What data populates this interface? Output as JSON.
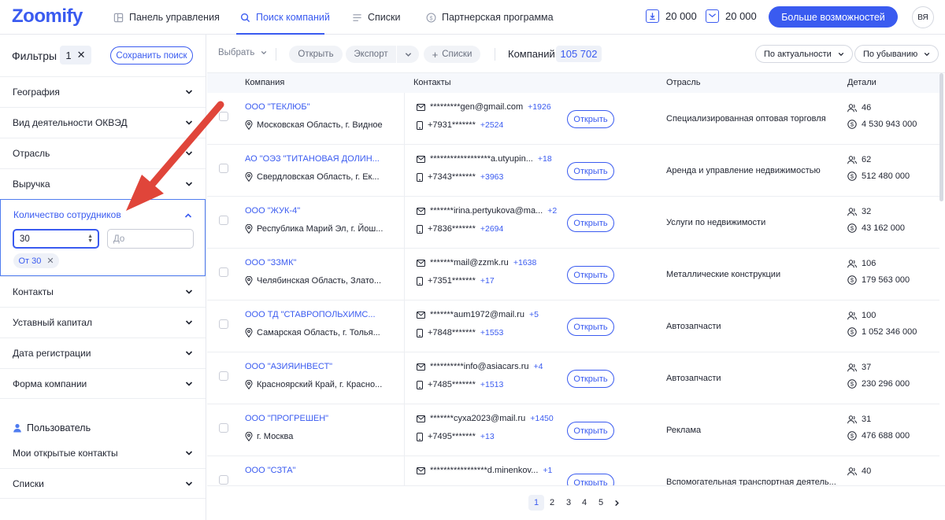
{
  "app": {
    "logo": "Zoomify"
  },
  "nav": [
    {
      "label": "Панель управления",
      "icon": "dashboard-icon"
    },
    {
      "label": "Поиск компаний",
      "icon": "search-icon",
      "active": true
    },
    {
      "label": "Списки",
      "icon": "list-icon"
    },
    {
      "label": "Партнерская программа",
      "icon": "dollar-icon"
    }
  ],
  "header": {
    "downloads": "20 000",
    "emails": "20 000",
    "more_button": "Больше возможностей",
    "avatar": "ВЯ"
  },
  "sidebar": {
    "title": "Фильтры",
    "filter_count": "1",
    "save_search": "Сохранить поиск",
    "filters": [
      "География",
      "Вид деятельности ОКВЭД",
      "Отрасль",
      "Выручка"
    ],
    "open_filter": {
      "label": "Количество сотрудников",
      "from_value": "30",
      "to_placeholder": "До",
      "chip": "От 30"
    },
    "filters_after": [
      "Контакты",
      "Уставный капитал",
      "Дата регистрации",
      "Форма компании"
    ],
    "user_section": "Пользователь",
    "user_items": [
      "Мои открытые контакты",
      "Списки"
    ]
  },
  "toolbar": {
    "select": "Выбрать",
    "open": "Открыть",
    "export": "Экспорт",
    "lists": "Списки",
    "companies_label": "Компаний",
    "companies_count": "105 702",
    "sort_relevance": "По актуальности",
    "sort_order": "По убыванию"
  },
  "table": {
    "headers": {
      "company": "Компания",
      "contacts": "Контакты",
      "industry": "Отрасль",
      "details": "Детали"
    },
    "open_label": "Открыть",
    "rows": [
      {
        "name": "ООО \"ТЕКЛЮБ\"",
        "address": "Московская Область, г. Видное",
        "email": "*********gen@gmail.com",
        "email_more": "+1926",
        "phone": "+7931*******",
        "phone_more": "+2524",
        "industry": "Специализированная оптовая торговля",
        "employees": "46",
        "revenue": "4 530 943 000"
      },
      {
        "name": "АО \"ОЭЗ \"ТИТАНОВАЯ ДОЛИН...",
        "address": "Свердловская Область, г. Ек...",
        "email": "******************a.utyupin...",
        "email_more": "+18",
        "phone": "+7343*******",
        "phone_more": "+3963",
        "industry": "Аренда и управление недвижимостью",
        "employees": "62",
        "revenue": "512 480 000"
      },
      {
        "name": "ООО \"ЖУК-4\"",
        "address": "Республика Марий Эл, г. Йош...",
        "email": "*******irina.pertyukova@ma...",
        "email_more": "+2",
        "phone": "+7836*******",
        "phone_more": "+2694",
        "industry": "Услуги по недвижимости",
        "employees": "32",
        "revenue": "43 162 000"
      },
      {
        "name": "ООО \"ЗЗМК\"",
        "address": "Челябинская Область, Злато...",
        "email": "*******mail@zzmk.ru",
        "email_more": "+1638",
        "phone": "+7351*******",
        "phone_more": "+17",
        "industry": "Металлические конструкции",
        "employees": "106",
        "revenue": "179 563 000"
      },
      {
        "name": "ООО ТД \"СТАВРОПОЛЬХИМС...",
        "address": "Самарская Область, г. Толья...",
        "email": "*******aum1972@mail.ru",
        "email_more": "+5",
        "phone": "+7848*******",
        "phone_more": "+1553",
        "industry": "Автозапчасти",
        "employees": "100",
        "revenue": "1 052 346 000"
      },
      {
        "name": "ООО \"АЗИЯИНВЕСТ\"",
        "address": "Красноярский Край, г. Красно...",
        "email": "**********info@asiacars.ru",
        "email_more": "+4",
        "phone": "+7485*******",
        "phone_more": "+1513",
        "industry": "Автозапчасти",
        "employees": "37",
        "revenue": "230 296 000"
      },
      {
        "name": "ООО \"ПРОГРЕШЕН\"",
        "address": "г. Москва",
        "email": "*******cyxa2023@mail.ru",
        "email_more": "+1450",
        "phone": "+7495*******",
        "phone_more": "+13",
        "industry": "Реклама",
        "employees": "31",
        "revenue": "476 688 000"
      },
      {
        "name": "ООО \"СЗТА\"",
        "address": "",
        "email": "*****************d.minenkov...",
        "email_more": "+1",
        "phone": "",
        "phone_more": "",
        "industry": "Вспомогательная транспортная деятель...",
        "employees": "40",
        "revenue": ""
      }
    ]
  },
  "pagination": [
    "1",
    "2",
    "3",
    "4",
    "5"
  ],
  "colors": {
    "accent": "#3a5bf0",
    "annotation_arrow": "#e0453a"
  }
}
